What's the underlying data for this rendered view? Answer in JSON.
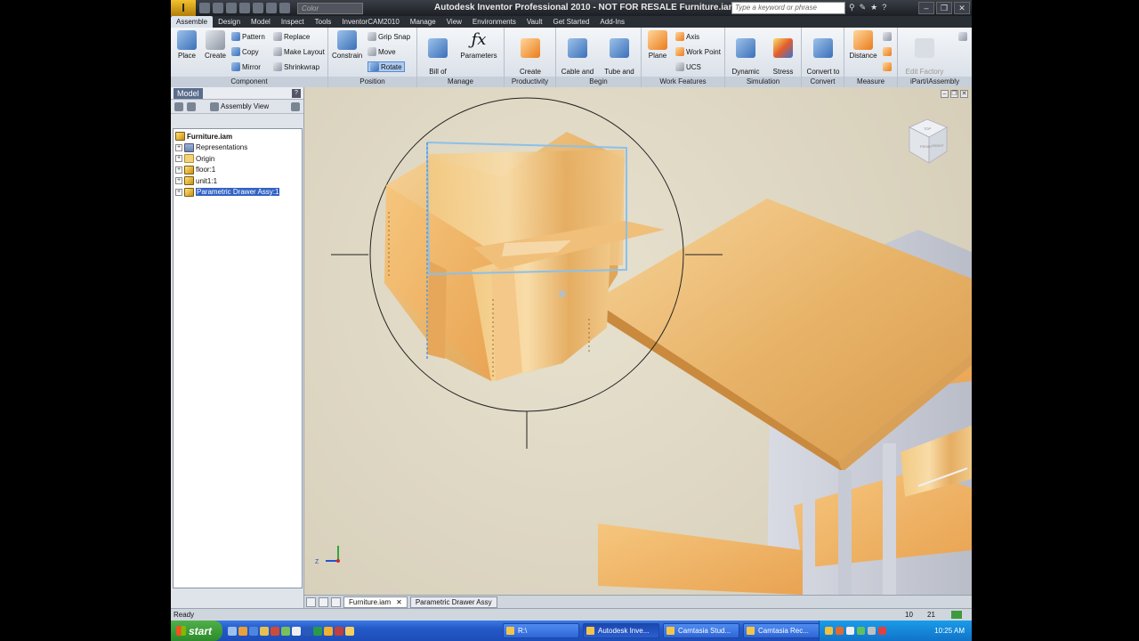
{
  "app": {
    "button_label": "I",
    "title": "Autodesk Inventor Professional 2010 - NOT FOR RESALE    Furniture.iam",
    "color_placeholder": "Color",
    "search_placeholder": "Type a keyword or phrase"
  },
  "tabs": [
    "Assemble",
    "Design",
    "Model",
    "Inspect",
    "Tools",
    "InventorCAM2010",
    "Manage",
    "View",
    "Environments",
    "Vault",
    "Get Started",
    "Add-Ins"
  ],
  "ribbon": {
    "component": {
      "title": "Component",
      "place": "Place",
      "create": "Create",
      "pattern": "Pattern",
      "copy": "Copy",
      "mirror": "Mirror",
      "replace": "Replace",
      "make_layout": "Make Layout",
      "shrinkwrap": "Shrinkwrap"
    },
    "position": {
      "title": "Position",
      "constrain": "Constrain",
      "grip_snap": "Grip Snap",
      "move": "Move",
      "rotate": "Rotate"
    },
    "manage": {
      "title": "Manage",
      "bom": "Bill of\nMaterials",
      "parameters": "Parameters"
    },
    "productivity": {
      "title": "Productivity",
      "create_substitutes": "Create\nSubstitutes"
    },
    "begin": {
      "title": "Begin",
      "cable_harness": "Cable and\nHarness",
      "tube_pipe": "Tube and\nPipe"
    },
    "work_features": {
      "title": "Work Features",
      "plane": "Plane",
      "axis": "Axis",
      "work_point": "Work Point",
      "ucs": "UCS"
    },
    "simulation": {
      "title": "Simulation",
      "dynamic": "Dynamic\nSimulation",
      "stress": "Stress\nAnalysis"
    },
    "convert": {
      "title": "Convert",
      "weldment": "Convert to\nWeldment"
    },
    "measure": {
      "title": "Measure",
      "distance": "Distance"
    },
    "ipart": {
      "title": "iPart/iAssembly",
      "edit_scope": "Edit Factory\nScope"
    }
  },
  "browser": {
    "title": "Model",
    "assembly_view": "Assembly View",
    "tree": [
      {
        "label": "Furniture.iam",
        "type": "root"
      },
      {
        "label": "Representations",
        "type": "rep"
      },
      {
        "label": "Origin",
        "type": "folder"
      },
      {
        "label": "floor:1",
        "type": "asm"
      },
      {
        "label": "unit1:1",
        "type": "asm"
      },
      {
        "label": "Parametric Drawer Assy:1",
        "type": "asm",
        "selected": true
      }
    ]
  },
  "viewcube": {
    "front": "FRONT",
    "right": "RIGHT",
    "top": "TOP"
  },
  "triad": {
    "z": "Z"
  },
  "doc_tabs": [
    "Furniture.iam",
    "Parametric Drawer Assy"
  ],
  "status": {
    "text": "Ready",
    "n1": "10",
    "n2": "21"
  },
  "taskbar": {
    "start": "start",
    "tasks": [
      "R:\\",
      "Autodesk Inve...",
      "Camtasia Stud...",
      "Camtasia Rec..."
    ],
    "clock": "10:25 AM"
  }
}
